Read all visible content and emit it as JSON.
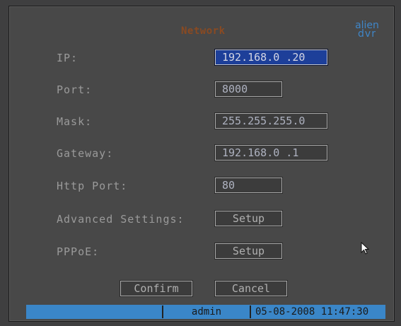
{
  "title": "Network",
  "logo": {
    "line1": "alien",
    "line2": "dvr"
  },
  "fields": {
    "ip": {
      "label": "IP:",
      "value": "192.168.0  .20"
    },
    "port": {
      "label": "Port:",
      "value": "8000"
    },
    "mask": {
      "label": "Mask:",
      "value": "255.255.255.0"
    },
    "gateway": {
      "label": "Gateway:",
      "value": "192.168.0  .1"
    },
    "http_port": {
      "label": "Http Port:",
      "value": "80"
    },
    "advanced": {
      "label": "Advanced Settings:",
      "button": "Setup"
    },
    "pppoe": {
      "label": "PPPoE:",
      "button": "Setup"
    }
  },
  "buttons": {
    "confirm": "Confirm",
    "cancel": "Cancel"
  },
  "status_bar": {
    "user": "admin",
    "datetime": "05-08-2008 11:47:30",
    "color": "#3a86c8"
  },
  "colors": {
    "selected_field": "#1d3f99",
    "title": "#8a4a22",
    "logo": "#3f86c8"
  },
  "icons": {
    "pointer": "mouse-pointer-icon"
  }
}
